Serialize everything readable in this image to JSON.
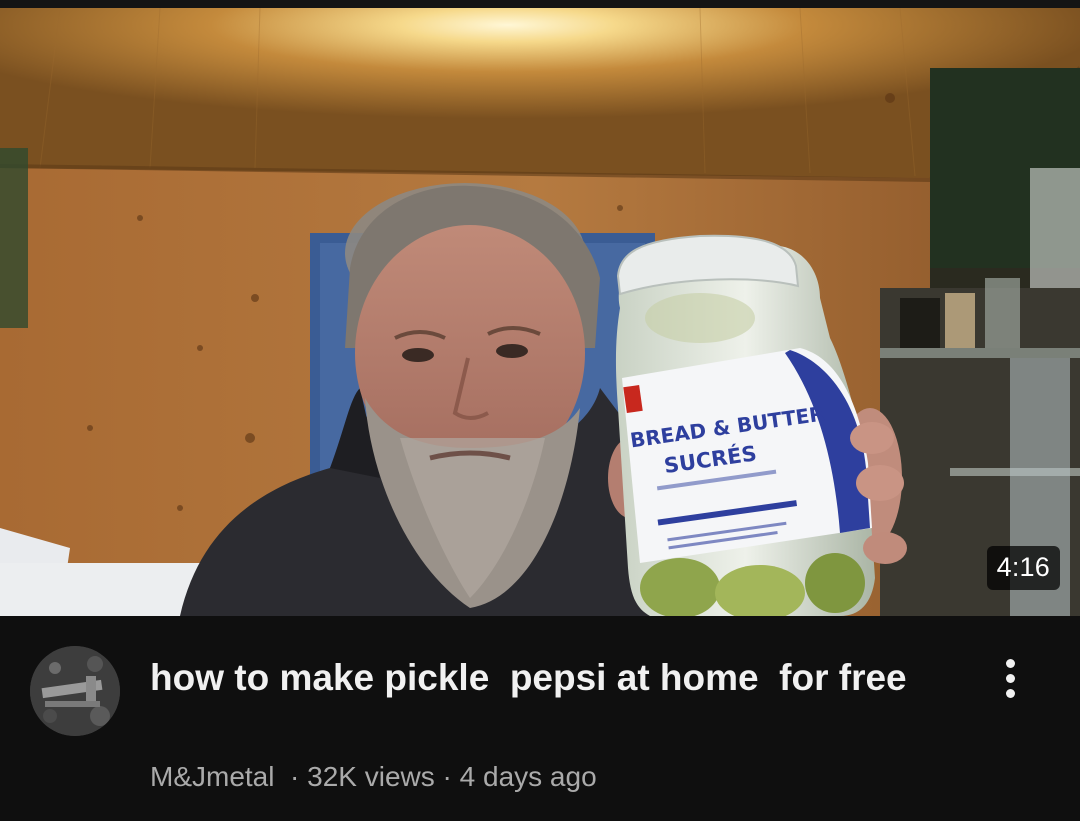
{
  "video": {
    "title": "how to make pickle  pepsi at home  for free",
    "duration": "4:16",
    "channel": "M&Jmetal",
    "views": "32K views",
    "age": "4 days ago",
    "separator": "·"
  },
  "thumbnail": {
    "jar_label": {
      "line1": "BREAD & BUTTER",
      "line2": "SUCRÉS"
    }
  },
  "menu": {
    "icon": "more-vert-icon"
  },
  "colors": {
    "background": "#0f0f0f",
    "title": "#f1f1f1",
    "secondary_text": "#aaaaaa",
    "jar_label_blue": "#2e3f9e"
  }
}
